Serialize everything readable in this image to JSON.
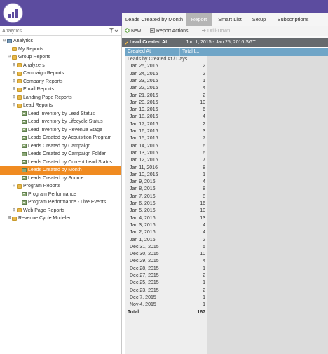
{
  "app": {
    "brand_color": "#5c4c9f",
    "accent_color": "#f08b21"
  },
  "tabs": [
    {
      "label": "Leads Created by Month",
      "active": false
    },
    {
      "label": "Report",
      "active": true
    },
    {
      "label": "Smart List",
      "active": false
    },
    {
      "label": "Setup",
      "active": false
    },
    {
      "label": "Subscriptions",
      "active": false
    }
  ],
  "search": {
    "placeholder": "Analytics...",
    "filter_icon": "filter-icon"
  },
  "tree": [
    {
      "label": "Analytics",
      "icon": "root",
      "twist": "-",
      "level": 0
    },
    {
      "label": "My Reports",
      "icon": "folder",
      "twist": "",
      "level": 1
    },
    {
      "label": "Group Reports",
      "icon": "folder",
      "twist": "-",
      "level": 1
    },
    {
      "label": "Analyzers",
      "icon": "folder",
      "twist": "+",
      "level": 2
    },
    {
      "label": "Campaign Reports",
      "icon": "folder",
      "twist": "+",
      "level": 2
    },
    {
      "label": "Company Reports",
      "icon": "folder",
      "twist": "+",
      "level": 2
    },
    {
      "label": "Email Reports",
      "icon": "folder",
      "twist": "+",
      "level": 2
    },
    {
      "label": "Landing Page Reports",
      "icon": "folder",
      "twist": "+",
      "level": 2
    },
    {
      "label": "Lead Reports",
      "icon": "folder",
      "twist": "-",
      "level": 2
    },
    {
      "label": "Lead Inventory by Lead Status",
      "icon": "report",
      "twist": "",
      "level": 3
    },
    {
      "label": "Lead Inventory by Lifecycle Status",
      "icon": "report",
      "twist": "",
      "level": 3
    },
    {
      "label": "Lead Inventory by Revenue Stage",
      "icon": "report",
      "twist": "",
      "level": 3
    },
    {
      "label": "Leads Created by Acquisition Program",
      "icon": "report",
      "twist": "",
      "level": 3
    },
    {
      "label": "Leads Created by Campaign",
      "icon": "report",
      "twist": "",
      "level": 3
    },
    {
      "label": "Leads Created by Campaign Folder",
      "icon": "report",
      "twist": "",
      "level": 3
    },
    {
      "label": "Leads Created by Current Lead Status",
      "icon": "report",
      "twist": "",
      "level": 3
    },
    {
      "label": "Leads Created by Month",
      "icon": "report",
      "twist": "",
      "level": 3,
      "selected": true
    },
    {
      "label": "Leads Created by Source",
      "icon": "report",
      "twist": "",
      "level": 3
    },
    {
      "label": "Program Reports",
      "icon": "folder",
      "twist": "-",
      "level": 2
    },
    {
      "label": "Program Performance",
      "icon": "report",
      "twist": "",
      "level": 3
    },
    {
      "label": "Program Performance - Live Events",
      "icon": "report",
      "twist": "",
      "level": 3
    },
    {
      "label": "Web Page Reports",
      "icon": "folder",
      "twist": "+",
      "level": 2
    },
    {
      "label": "Revenue Cycle Modeler",
      "icon": "folder",
      "twist": "+",
      "level": 1
    }
  ],
  "toolbar": {
    "new_label": "New",
    "report_actions_label": "Report Actions",
    "drill_down_label": "Drill-Down"
  },
  "filter": {
    "label": "Lead Created At:",
    "value": "Jun 1, 2015 - Jan 25, 2016 SGT"
  },
  "grid": {
    "columns": [
      "Created At",
      "Total L..."
    ],
    "group_label": "Leads by Created At / Days",
    "rows": [
      {
        "date": "Jan 25, 2016",
        "total": "2"
      },
      {
        "date": "Jan 24, 2016",
        "total": "2"
      },
      {
        "date": "Jan 23, 2016",
        "total": "1"
      },
      {
        "date": "Jan 22, 2016",
        "total": "4"
      },
      {
        "date": "Jan 21, 2016",
        "total": "2"
      },
      {
        "date": "Jan 20, 2016",
        "total": "10"
      },
      {
        "date": "Jan 19, 2016",
        "total": "6"
      },
      {
        "date": "Jan 18, 2016",
        "total": "4"
      },
      {
        "date": "Jan 17, 2016",
        "total": "2"
      },
      {
        "date": "Jan 16, 2016",
        "total": "3"
      },
      {
        "date": "Jan 15, 2016",
        "total": "7"
      },
      {
        "date": "Jan 14, 2016",
        "total": "6"
      },
      {
        "date": "Jan 13, 2016",
        "total": "6"
      },
      {
        "date": "Jan 12, 2016",
        "total": "7"
      },
      {
        "date": "Jan 11, 2016",
        "total": "8"
      },
      {
        "date": "Jan 10, 2016",
        "total": "1"
      },
      {
        "date": "Jan 9, 2016",
        "total": "4"
      },
      {
        "date": "Jan 8, 2016",
        "total": "8"
      },
      {
        "date": "Jan 7, 2016",
        "total": "8"
      },
      {
        "date": "Jan 6, 2016",
        "total": "16"
      },
      {
        "date": "Jan 5, 2016",
        "total": "10"
      },
      {
        "date": "Jan 4, 2016",
        "total": "13"
      },
      {
        "date": "Jan 3, 2016",
        "total": "4"
      },
      {
        "date": "Jan 2, 2016",
        "total": "4"
      },
      {
        "date": "Jan 1, 2016",
        "total": "2"
      },
      {
        "date": "Dec 31, 2015",
        "total": "5"
      },
      {
        "date": "Dec 30, 2015",
        "total": "10"
      },
      {
        "date": "Dec 29, 2015",
        "total": "4"
      },
      {
        "date": "Dec 28, 2015",
        "total": "1"
      },
      {
        "date": "Dec 27, 2015",
        "total": "2"
      },
      {
        "date": "Dec 25, 2015",
        "total": "1"
      },
      {
        "date": "Dec 23, 2015",
        "total": "2"
      },
      {
        "date": "Dec 7, 2015",
        "total": "1"
      },
      {
        "date": "Nov 4, 2015",
        "total": "1"
      }
    ],
    "total_label": "Total:",
    "total_value": "167"
  }
}
